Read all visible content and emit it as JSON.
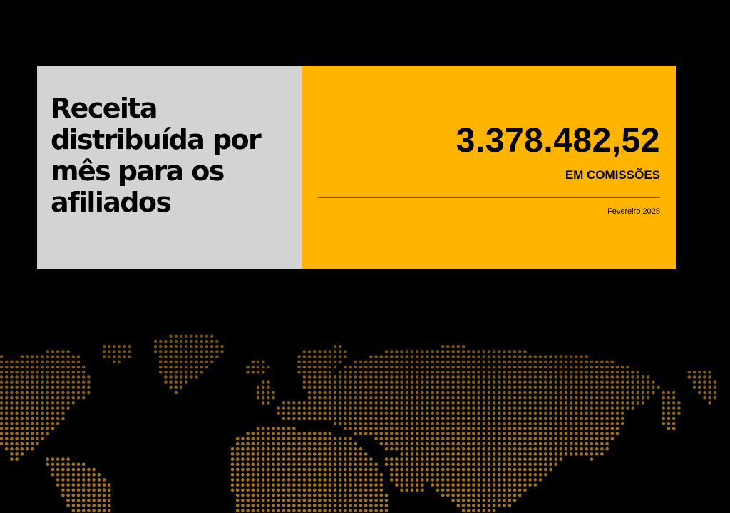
{
  "headline": {
    "text": "Receita distribuída por mês para os afiliados"
  },
  "stat": {
    "value": "3.378.482,52",
    "label": "EM COMISSÕES",
    "period": "Fevereiro 2025"
  },
  "colors": {
    "background": "#000000",
    "panel_left": "#d3d3d3",
    "panel_right": "#ffb400",
    "map_dots": "#b8811a"
  },
  "decoration": {
    "icon": "dotted-world-map"
  }
}
